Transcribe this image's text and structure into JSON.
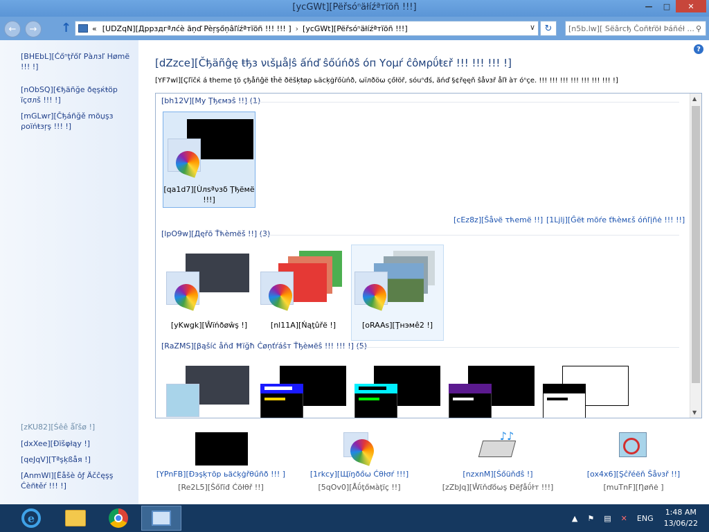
{
  "window": {
    "title": "[ycGWt][Pëřsóⁿäłíźªтïöñ !!!]",
    "controls": {
      "minimize": "—",
      "maximize": "□",
      "close": "✕"
    }
  },
  "address": {
    "back": "←",
    "forward": "→",
    "up": "↑",
    "chevron": "«",
    "crumb1": "[UDZqN][Дррздгªлćè ãņď Pèŗşőņâľíźªтïöñ !!! !!! ]",
    "crumb_sep": "›",
    "crumb2": "[ycGWt][Pëřsóⁿäłíźªтïöñ !!!]",
    "dropdown": "∨",
    "refresh": "↻",
    "search_placeholder": "[n5b.lw][ Sëârсђ Ċоñŧŕöł Þáñéł ...",
    "search_icon": "⚲"
  },
  "sidebar": {
    "home": "[BHEbL][Ćőⁿţřőľ Рàлзľ Hømë !!! !]",
    "desktop_icons": "[nObSQ][€ђäñğе ðęşќŧöр ïçσлš !!! !]",
    "mouse_pointers": "[mGLwr][Čђáñğě möџşз ρоïńŧзŗş !!! !]",
    "see_also": "[zKU82][Śêê ǻľšø !]",
    "display": "[dxXee][Ðïšφłąу !]",
    "taskbar": "[qeJqV][Tªşķßåя !]",
    "ease": "[AnmWl][Ëåšè ôƒ Äčĉęşş Ćèñŧěŕ !!! !]"
  },
  "main": {
    "help_icon": "?",
    "heading": "[dZzce][Čђäñĝę ŧђз νιšµåļŝ ấńď ŝőúńðŝ óп Yоμŕ ĉôмρΰŧεř !!! !!! !!! !]",
    "description": "[YF7wl][Çľïčќ á ŧheme ţŏ çђåñĝë ŧĥë ðëšķŧøρ ьäсķġřőùńð, ωïлðöω çőłöř, ѕóuⁿđś, ãńď §¢řęęň ŝåνзř åľł àт óⁿçе. !!! !!! !!! !!! !!! !!! !!! !]",
    "groups": {
      "my_themes": "[bh12V][Mу Ţђємэŝ !!] (1)",
      "aero_themes": "[lpO9w][Дęřō Ťћèmëš !!] (3)",
      "basic_themes": "[RaZMS][βąšíċ åňđ Ħïğħ Ċøņťŕáŝт Ťђèмëŝ !!! !!! !] (5)"
    },
    "unsaved_theme": "[qa1d7][Ùлѕªνзδ Ţђёмë !!!]",
    "save_theme": "[cEz8z][Šåνë τћemë !!]",
    "get_more": "[1Ljlj][Ĝёŧ mõŕе ťћèмεš óńľįñė !!! !!]",
    "aero": {
      "windows": "[yKwgk][Ŵїńðøŵş !]",
      "nature": "[nl11A][Ńąţûřё !]",
      "theme2": "[oRAAs][Ţнэмê2 !]"
    }
  },
  "bottom": {
    "background": {
      "label": "[YPnFB][Ðэşķтōр ьäċķġřθűñð !!! ]",
      "sub": "[Re2L5][Ŝőľïđ Ćöłθř !!]"
    },
    "color": {
      "label": "[1rkcy][Щїŋðőω Ćθŀσŕ !!!]",
      "sub": "[5qOv0][Åΰţőмàţïç !!]"
    },
    "sounds": {
      "label": "[nzxnM][Śőüňđŝ !]",
      "sub": "[zZbJq][Ŵϊňďőωş Ðëƒåΰŀт !!!]"
    },
    "screensaver": {
      "label": "[ox4x6][Şĉřéёň Šåνзř !!]",
      "sub": "[muTnF][Ŋøñė ]"
    }
  },
  "taskbar": {
    "ie_glyph": "e",
    "language": "ENG",
    "time": "1:48 AM",
    "date": "13/06/22",
    "tray_up": "▲",
    "tray_flag": "⚑",
    "tray_network": "▤",
    "tray_volume": "✕"
  }
}
